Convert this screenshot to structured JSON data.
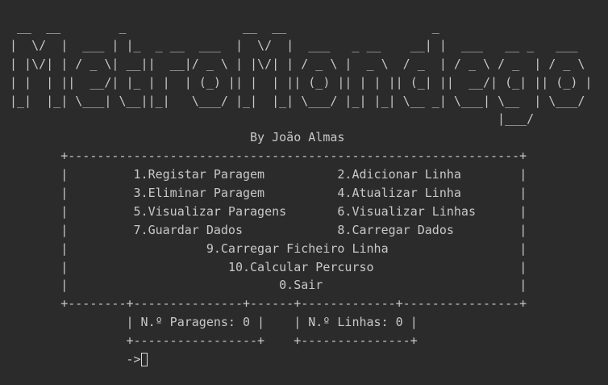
{
  "ascii_art": {
    "lines": [
      " __  __        _                __  __                    _",
      "|  \\/  |  ___ | |_  _ __  ___  |  \\/  |  ___   _ __    __| |  ___   __ _   ___",
      "| |\\/| | / _ \\| __||  __|/ _ \\ | |\\/| | / _ \\ |  _ \\  / _  | / _ \\ / _  | / _ \\",
      "| |  | ||  __/| |_ | |  | (_) || |  | || (_) || | | || (_| ||  __/| (_| || (_) |",
      "|_|  |_| \\___| \\__||_|   \\___/ |_|  |_| \\___/ |_| |_| \\__ _| \\___| \\__  | \\___/",
      "                                                                   |___/"
    ]
  },
  "author": "By João Almas",
  "menu": {
    "border_top": "+--------------------------------------------------------------+",
    "border_bottom": "+--------+---------------+------+-------------+----------------+",
    "side": "|",
    "items": [
      "1.Registar Paragem",
      "2.Adicionar Linha",
      "3.Eliminar Paragem",
      "4.Atualizar Linha",
      "5.Visualizar Paragens",
      "6.Visualizar Linhas",
      "7.Guardar Dados",
      "8.Carregar Dados",
      "9.Carregar Ficheiro Linha",
      "10.Calcular Percurso",
      "0.Sair"
    ]
  },
  "stats": {
    "paragens": "| N.º Paragens: 0 |",
    "linhas": "| N.º Linhas: 0 |",
    "paragens_border": "+-----------------+",
    "linhas_border": "+---------------+"
  },
  "prompt": "->"
}
